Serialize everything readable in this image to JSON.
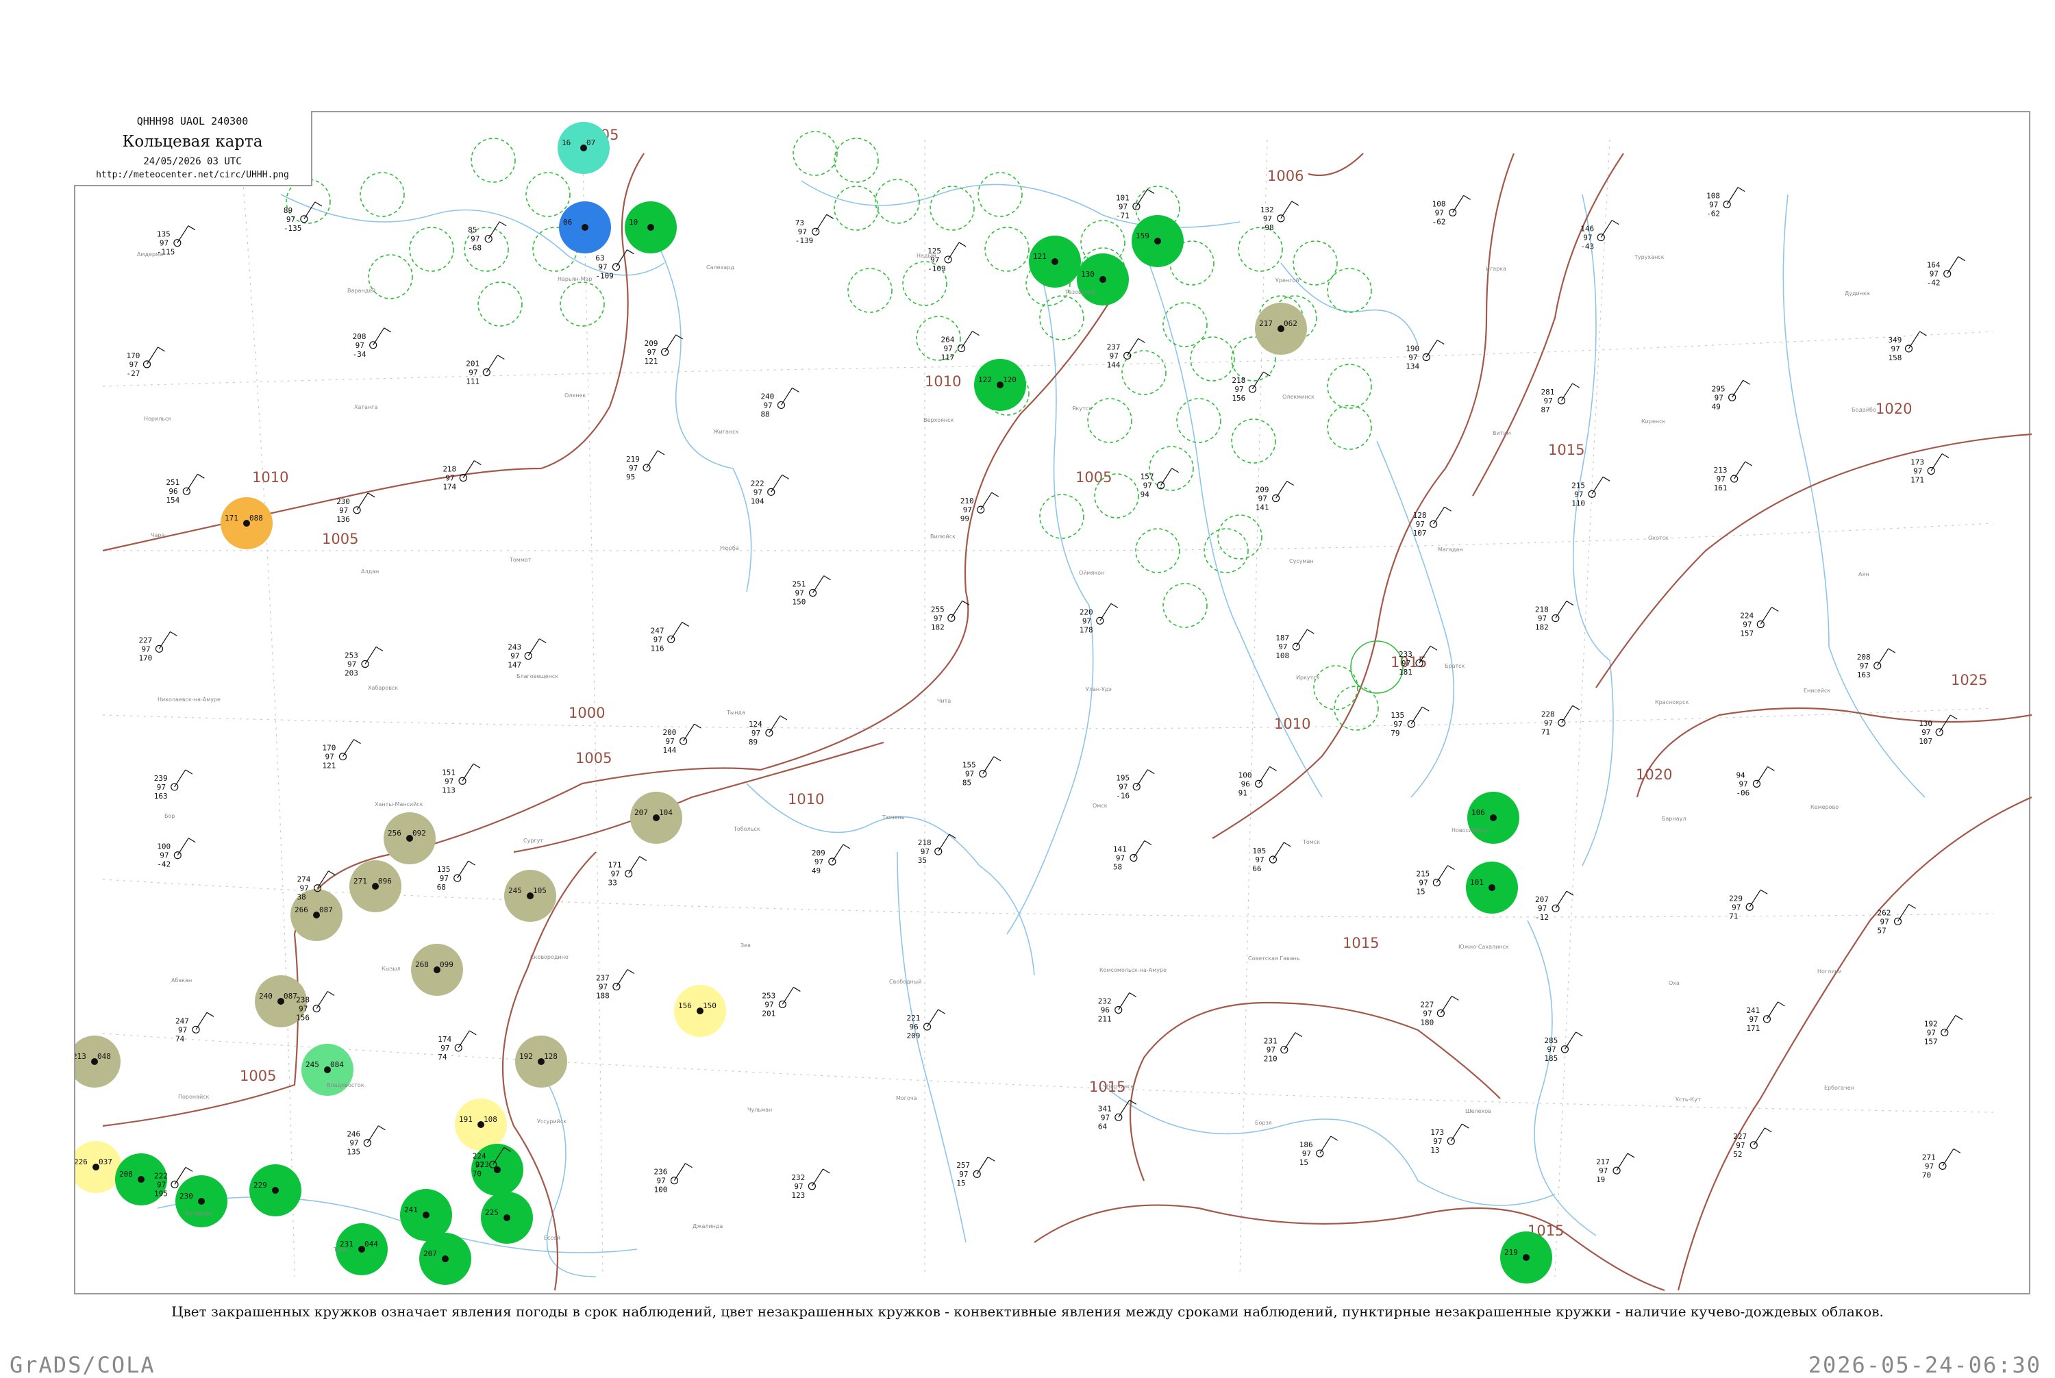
{
  "header": {
    "code_line": "QHHH98  UAOL  240300",
    "title": "Кольцевая карта",
    "datetime": "24/05/2026 03 UTC",
    "url": "http://meteocenter.net/circ/UHHH.png"
  },
  "caption": "Цвет закрашенных кружков означает явления погоды в срок наблюдений, цвет незакрашенных кружков - конвективные явления между сроками наблюдений, пунктирные незакрашенные кружки - наличие кучево-дождевых облаков.",
  "footer": {
    "left": "GrADS/COLA",
    "right": "2026-05-24-06:30"
  },
  "isobars": [
    {
      "label": "1005"
    },
    {
      "label": "1005"
    },
    {
      "label": "1005"
    },
    {
      "label": "1005"
    },
    {
      "label": "1010"
    },
    {
      "label": "1010"
    },
    {
      "label": "1010"
    },
    {
      "label": "1010"
    },
    {
      "label": "1000"
    },
    {
      "label": "1005"
    },
    {
      "label": "1006"
    },
    {
      "label": "1015"
    },
    {
      "label": "1015"
    },
    {
      "label": "1015"
    },
    {
      "label": "1015"
    },
    {
      "label": "1015"
    },
    {
      "label": "1020"
    },
    {
      "label": "1020"
    },
    {
      "label": "1025"
    }
  ],
  "colors": {
    "isobar": "#a4584a",
    "river": "#8ec5ea",
    "frame": "#9a9a9a",
    "rain_green": "#0cc23a",
    "cb_dashed": "#2fbf3a",
    "fog_olive": "#b9b98e",
    "haze_yellow": "#fff79a",
    "dust_orange": "#f6b443",
    "thunder_blue": "#2f80e6",
    "snow_teal": "#4ee0c0",
    "shower_lightgreen": "#62e08a"
  },
  "stations_filled": [
    {
      "top": "16",
      "bottom": "07",
      "color": "snow_teal"
    },
    {
      "top": "06",
      "bottom": "",
      "color": "thunder_blue"
    },
    {
      "top": "10",
      "bottom": "",
      "color": "rain_green"
    },
    {
      "top": "171",
      "bottom": "088",
      "color": "dust_orange"
    },
    {
      "top": "217",
      "bottom": "062",
      "color": "fog_olive"
    },
    {
      "top": "122",
      "bottom": "120",
      "color": "rain_green"
    },
    {
      "top": "207",
      "bottom": "104",
      "color": "fog_olive"
    },
    {
      "top": "256",
      "bottom": "092",
      "color": "fog_olive"
    },
    {
      "top": "271",
      "bottom": "096",
      "color": "fog_olive"
    },
    {
      "top": "245",
      "bottom": "105",
      "color": "fog_olive"
    },
    {
      "top": "266",
      "bottom": "087",
      "color": "fog_olive"
    },
    {
      "top": "268",
      "bottom": "099",
      "color": "fog_olive"
    },
    {
      "top": "240",
      "bottom": "087",
      "color": "fog_olive"
    },
    {
      "top": "213",
      "bottom": "048",
      "color": "fog_olive"
    },
    {
      "top": "192",
      "bottom": "128",
      "color": "fog_olive"
    },
    {
      "top": "245",
      "bottom": "084",
      "color": "shower_lightgreen"
    },
    {
      "top": "156",
      "bottom": "150",
      "color": "haze_yellow"
    },
    {
      "top": "191",
      "bottom": "108",
      "color": "haze_yellow"
    },
    {
      "top": "226",
      "bottom": "037",
      "color": "haze_yellow"
    },
    {
      "top": "208",
      "bottom": "",
      "color": "rain_green"
    },
    {
      "top": "230",
      "bottom": "",
      "color": "rain_green"
    },
    {
      "top": "229",
      "bottom": "",
      "color": "rain_green"
    },
    {
      "top": "231",
      "bottom": "044",
      "color": "rain_green"
    },
    {
      "top": "241",
      "bottom": "",
      "color": "rain_green"
    },
    {
      "top": "207",
      "bottom": "",
      "color": "rain_green"
    },
    {
      "top": "223",
      "bottom": "",
      "color": "rain_green"
    },
    {
      "top": "225",
      "bottom": "",
      "color": "rain_green"
    },
    {
      "top": "106",
      "bottom": "",
      "color": "rain_green"
    },
    {
      "top": "101",
      "bottom": "",
      "color": "rain_green"
    },
    {
      "top": "219",
      "bottom": "",
      "color": "rain_green"
    },
    {
      "top": "121",
      "bottom": "",
      "color": "rain_green"
    },
    {
      "top": "130",
      "bottom": "",
      "color": "rain_green"
    },
    {
      "top": "159",
      "bottom": "",
      "color": "rain_green"
    }
  ],
  "stations_plain": [
    {
      "t": "135",
      "p": "97",
      "v": "-115"
    },
    {
      "t": "89",
      "p": "97",
      "v": "-135"
    },
    {
      "t": "85",
      "p": "97",
      "v": "-68"
    },
    {
      "t": "63",
      "p": "97",
      "v": "-109"
    },
    {
      "t": "73",
      "p": "97",
      "v": "-139"
    },
    {
      "t": "125",
      "p": "97",
      "v": "-109"
    },
    {
      "t": "101",
      "p": "97",
      "v": "-71"
    },
    {
      "t": "132",
      "p": "97",
      "v": "-98"
    },
    {
      "t": "108",
      "p": "97",
      "v": "-62"
    },
    {
      "t": "146",
      "p": "97",
      "v": "-43"
    },
    {
      "t": "108",
      "p": "97",
      "v": "-62"
    },
    {
      "t": "164",
      "p": "97",
      "v": "-42"
    },
    {
      "t": "170",
      "p": "97",
      "v": "-27"
    },
    {
      "t": "208",
      "p": "97",
      "v": "-34"
    },
    {
      "t": "201",
      "p": "97",
      "v": "111"
    },
    {
      "t": "209",
      "p": "97",
      "v": "121"
    },
    {
      "t": "240",
      "p": "97",
      "v": "88"
    },
    {
      "t": "264",
      "p": "97",
      "v": "117"
    },
    {
      "t": "237",
      "p": "97",
      "v": "144"
    },
    {
      "t": "218",
      "p": "97",
      "v": "156"
    },
    {
      "t": "190",
      "p": "97",
      "v": "134"
    },
    {
      "t": "281",
      "p": "97",
      "v": "87"
    },
    {
      "t": "295",
      "p": "97",
      "v": "49"
    },
    {
      "t": "349",
      "p": "97",
      "v": "158"
    },
    {
      "t": "251",
      "p": "96",
      "v": "154"
    },
    {
      "t": "230",
      "p": "97",
      "v": "136"
    },
    {
      "t": "218",
      "p": "97",
      "v": "174"
    },
    {
      "t": "219",
      "p": "97",
      "v": "95"
    },
    {
      "t": "222",
      "p": "97",
      "v": "104"
    },
    {
      "t": "210",
      "p": "97",
      "v": "99"
    },
    {
      "t": "157",
      "p": "97",
      "v": "94"
    },
    {
      "t": "209",
      "p": "97",
      "v": "141"
    },
    {
      "t": "128",
      "p": "97",
      "v": "107"
    },
    {
      "t": "215",
      "p": "97",
      "v": "110"
    },
    {
      "t": "213",
      "p": "97",
      "v": "161"
    },
    {
      "t": "173",
      "p": "97",
      "v": "171"
    },
    {
      "t": "227",
      "p": "97",
      "v": "170"
    },
    {
      "t": "253",
      "p": "97",
      "v": "203"
    },
    {
      "t": "243",
      "p": "97",
      "v": "147"
    },
    {
      "t": "247",
      "p": "97",
      "v": "116"
    },
    {
      "t": "251",
      "p": "97",
      "v": "150"
    },
    {
      "t": "255",
      "p": "97",
      "v": "182"
    },
    {
      "t": "220",
      "p": "97",
      "v": "178"
    },
    {
      "t": "187",
      "p": "97",
      "v": "108"
    },
    {
      "t": "233",
      "p": "97",
      "v": "181"
    },
    {
      "t": "218",
      "p": "97",
      "v": "182"
    },
    {
      "t": "224",
      "p": "97",
      "v": "157"
    },
    {
      "t": "208",
      "p": "97",
      "v": "163"
    },
    {
      "t": "239",
      "p": "97",
      "v": "163"
    },
    {
      "t": "170",
      "p": "97",
      "v": "121"
    },
    {
      "t": "151",
      "p": "97",
      "v": "113"
    },
    {
      "t": "200",
      "p": "97",
      "v": "144"
    },
    {
      "t": "124",
      "p": "97",
      "v": "89"
    },
    {
      "t": "155",
      "p": "97",
      "v": "85"
    },
    {
      "t": "195",
      "p": "97",
      "v": "-16"
    },
    {
      "t": "100",
      "p": "96",
      "v": "91"
    },
    {
      "t": "135",
      "p": "97",
      "v": "79"
    },
    {
      "t": "228",
      "p": "97",
      "v": "71"
    },
    {
      "t": "94",
      "p": "97",
      "v": "-06"
    },
    {
      "t": "130",
      "p": "97",
      "v": "107"
    },
    {
      "t": "100",
      "p": "97",
      "v": "-42"
    },
    {
      "t": "274",
      "p": "97",
      "v": "38"
    },
    {
      "t": "135",
      "p": "97",
      "v": "68"
    },
    {
      "t": "171",
      "p": "97",
      "v": "33"
    },
    {
      "t": "209",
      "p": "97",
      "v": "49"
    },
    {
      "t": "218",
      "p": "97",
      "v": "35"
    },
    {
      "t": "141",
      "p": "97",
      "v": "58"
    },
    {
      "t": "105",
      "p": "97",
      "v": "66"
    },
    {
      "t": "215",
      "p": "97",
      "v": "15"
    },
    {
      "t": "207",
      "p": "97",
      "v": "-12"
    },
    {
      "t": "229",
      "p": "97",
      "v": "71"
    },
    {
      "t": "262",
      "p": "97",
      "v": "57"
    },
    {
      "t": "247",
      "p": "97",
      "v": "74"
    },
    {
      "t": "238",
      "p": "97",
      "v": "156"
    },
    {
      "t": "174",
      "p": "97",
      "v": "74"
    },
    {
      "t": "237",
      "p": "97",
      "v": "188"
    },
    {
      "t": "253",
      "p": "97",
      "v": "201"
    },
    {
      "t": "221",
      "p": "96",
      "v": "209"
    },
    {
      "t": "232",
      "p": "96",
      "v": "211"
    },
    {
      "t": "231",
      "p": "97",
      "v": "210"
    },
    {
      "t": "227",
      "p": "97",
      "v": "180"
    },
    {
      "t": "285",
      "p": "97",
      "v": "185"
    },
    {
      "t": "241",
      "p": "97",
      "v": "171"
    },
    {
      "t": "192",
      "p": "97",
      "v": "157"
    },
    {
      "t": "222",
      "p": "97",
      "v": "195"
    },
    {
      "t": "246",
      "p": "97",
      "v": "135"
    },
    {
      "t": "224",
      "p": "97",
      "v": "70"
    },
    {
      "t": "236",
      "p": "97",
      "v": "100"
    },
    {
      "t": "232",
      "p": "97",
      "v": "123"
    },
    {
      "t": "257",
      "p": "97",
      "v": "15"
    },
    {
      "t": "341",
      "p": "97",
      "v": "64"
    },
    {
      "t": "186",
      "p": "97",
      "v": "15"
    },
    {
      "t": "173",
      "p": "97",
      "v": "13"
    },
    {
      "t": "217",
      "p": "97",
      "v": "19"
    },
    {
      "t": "227",
      "p": "97",
      "v": "52"
    },
    {
      "t": "271",
      "p": "97",
      "v": "70"
    }
  ],
  "station_names": [
    "Амдерма",
    "Варандей",
    "Нарьян-Мар",
    "Салехард",
    "Надым",
    "Тазовский",
    "Уренгой",
    "Игарка",
    "Туруханск",
    "Дудинка",
    "Норильск",
    "Хатанга",
    "Оленек",
    "Жиганск",
    "Верхоянск",
    "Якутск",
    "Олекминск",
    "Витим",
    "Киренск",
    "Бодайбо",
    "Чара",
    "Алдан",
    "Томмот",
    "Нюрба",
    "Вилюйск",
    "Оймякон",
    "Сусуман",
    "Магадан",
    "Охотск",
    "Аян",
    "Николаевск-на-Амуре",
    "Хабаровск",
    "Благовещенск",
    "Тында",
    "Чита",
    "Улан-Удэ",
    "Иркутск",
    "Братск",
    "Красноярск",
    "Енисейск",
    "Бор",
    "Ханты-Мансийск",
    "Сургут",
    "Тобольск",
    "Тюмень",
    "Омск",
    "Томск",
    "Новосибирск",
    "Барнаул",
    "Кемерово",
    "Абакан",
    "Кызыл",
    "Сковородино",
    "Зея",
    "Свободный",
    "Комсомольск-на-Амуре",
    "Советская Гавань",
    "Южно-Сахалинск",
    "Оха",
    "Ноглики",
    "Поронайск",
    "Владивосток",
    "Уссурийск",
    "Чульман",
    "Могоча",
    "Нерчинск",
    "Борзя",
    "Шелехов",
    "Усть-Кут",
    "Ербогачен",
    "Ванавара",
    "Тура",
    "Ессей",
    "Джалинда"
  ]
}
